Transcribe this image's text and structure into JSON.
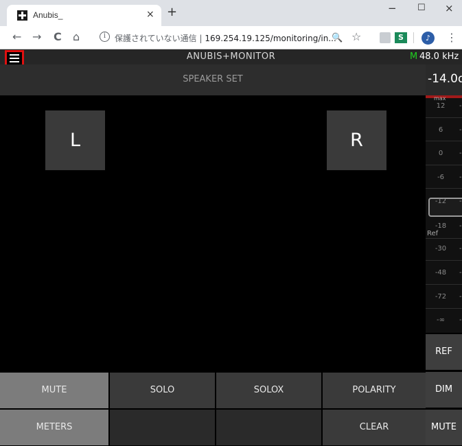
{
  "browser": {
    "tab_title": "Anubis_",
    "tab_close_glyph": "×",
    "new_tab_glyph": "+",
    "window_controls": [
      "−",
      "☐",
      "×"
    ],
    "nav_icons": [
      "back-icon",
      "forward-icon",
      "reload-icon",
      "home-icon"
    ],
    "nav_glyphs": [
      "←",
      "→",
      "C",
      "⌂"
    ],
    "security_label": "保護されていない通信",
    "address_separator": "|",
    "url": "169.254.19.125/monitoring/in...",
    "right_glyphs": [
      "🔍",
      "☆"
    ],
    "extension_s_label": "S",
    "menu_glyph": "⋮"
  },
  "app": {
    "title": "ANUBIS+MONITOR",
    "sample_rate_mode": "M",
    "sample_rate": "48.0 kHz",
    "speaker_set_title": "SPEAKER SET",
    "level_readout": "-14.0d",
    "speakers": [
      "L",
      "R"
    ],
    "meter": {
      "max_label": "max",
      "ref_label": "Ref",
      "ticks": [
        "12",
        "6",
        "0",
        "-6",
        "-12",
        "-18",
        "-30",
        "-48",
        "-72",
        "-∞"
      ],
      "tick_dash": "-"
    },
    "buttons_row1": [
      "MUTE",
      "SOLO",
      "SOLOX",
      "POLARITY"
    ],
    "buttons_row2": [
      "METERS",
      "",
      "",
      "CLEAR"
    ],
    "side_buttons": [
      "REF",
      "DIM",
      "MUTE"
    ],
    "accent_colors": {
      "mode_green": "#20d020",
      "menu_highlight_red": "#e01010",
      "meter_max_red": "#a21a1a"
    }
  }
}
